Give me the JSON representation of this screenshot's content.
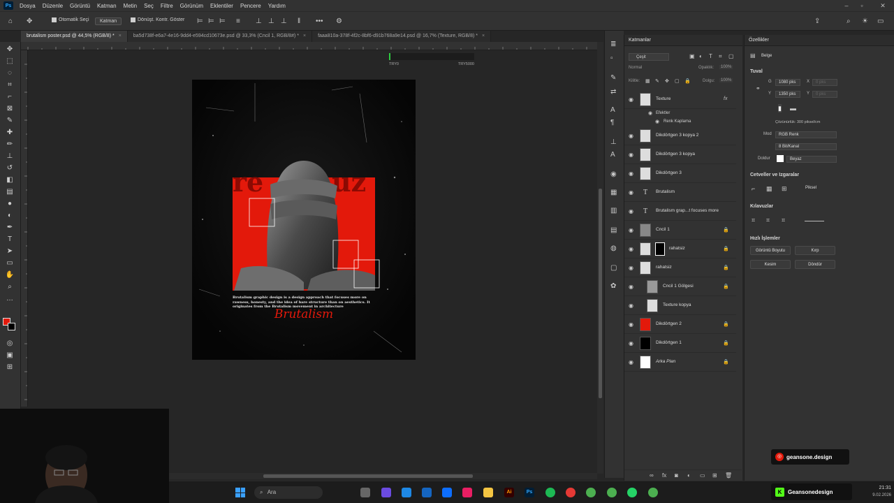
{
  "app": {
    "logo": "Ps",
    "menu": [
      "Dosya",
      "Düzenle",
      "Görüntü",
      "Katman",
      "Metin",
      "Seç",
      "Filtre",
      "Görünüm",
      "Eklentiler",
      "Pencere",
      "Yardım"
    ]
  },
  "options_bar": {
    "auto_select_label": "Otomatik Seçi",
    "auto_select_target": "Katman",
    "transform_controls_label": "Dönüşt. Kontr. Göster"
  },
  "tabs": [
    {
      "label": "brutalism poster.psd @ 44,5% (RGB/8) *",
      "active": true
    },
    {
      "label": "ba5d738f-e6a7-4e16-9dd4-e594cd10673e.psd @ 33,3% (Cncil 1, RGB/8#) *",
      "active": false
    },
    {
      "label": "faaa810a-378f-4f2c-8bf6-d91b768a9e14.psd @ 16,7% (Texture, RGB/8) *",
      "active": false
    }
  ],
  "progress": {
    "left_label": "TRY0",
    "right_label": "TRY5000",
    "value_pct": 2
  },
  "poster": {
    "title": "Brutalism",
    "body": "Brutalism graphic design is a design approach that focuses more on rawness, honesty, and the idea of bare structure than on aesthetics. It originates from the Brutalism movement in architecture"
  },
  "layers_panel": {
    "title": "Katmanlar",
    "filter_label": "Çeşit",
    "blend_mode": "Normal",
    "opacity_label": "Opaklık:",
    "opacity_value": "100%",
    "lock_label": "Kilitle:",
    "fill_label": "Dolgu:",
    "fill_value": "100%",
    "effects_label": "Efektler",
    "color_overlay_label": "Renk Kaplama",
    "layers": [
      {
        "name": "Texture",
        "kind": "pixel",
        "fx": true
      },
      {
        "name": "Dikdörtgen 3 kopya 2",
        "kind": "pixel"
      },
      {
        "name": "Dikdörtgen 3 kopya",
        "kind": "pixel"
      },
      {
        "name": "Dikdörtgen 3",
        "kind": "pixel"
      },
      {
        "name": "Brutalism",
        "kind": "text"
      },
      {
        "name": "Brutalism grap...t focuses more",
        "kind": "text"
      },
      {
        "name": "Cncil 1",
        "kind": "pixel",
        "locked": true
      },
      {
        "name": "rahatsiz",
        "kind": "pixel",
        "locked": true
      },
      {
        "name": "rahatsiz",
        "kind": "pixel",
        "locked": true
      },
      {
        "name": "Cncil 1 Gölgesi",
        "kind": "pixel",
        "locked": true
      },
      {
        "name": "Texture kopya",
        "kind": "pixel"
      },
      {
        "name": "Dikdörtgen 2",
        "kind": "pixel",
        "locked": true
      },
      {
        "name": "Dikdörtgen 1",
        "kind": "pixel",
        "locked": true
      },
      {
        "name": "Arka Plan",
        "kind": "bg",
        "locked": true
      }
    ]
  },
  "properties_panel": {
    "title": "Özellikler",
    "doc_label": "Belge",
    "canvas_section": "Tuval",
    "width_label": "G",
    "width_value": "1080 pks",
    "height_label": "Y",
    "height_value": "1350 pks",
    "x_label": "X",
    "x_value": "0 pks",
    "y_label": "Y",
    "y_value": "0 pks",
    "resolution": "Çözünürlük: 300 piksel/cm",
    "mode_label": "Mod",
    "mode_value": "RGB Renk",
    "bitdepth_value": "8 Bit/Kanal",
    "fill_label": "Doldur",
    "fill_value": "Beyaz",
    "rulers_section": "Cetveller ve Izgaralar",
    "rulers_unit": "Piksel",
    "guides_section": "Kılavuzlar",
    "quick_section": "Hızlı İşlemler",
    "quick_buttons": [
      "Görüntü Boyutu",
      "Kırp",
      "Kesim",
      "Döndür"
    ]
  },
  "taskbar": {
    "search_label": "Ara",
    "time": "21:31",
    "date": "9.02.2026",
    "badge1": "geansone.design",
    "badge2": "Geansonedesign"
  },
  "colors": {
    "accent_red": "#e3190b",
    "panel_bg": "#323232",
    "canvas_bg": "#262626"
  }
}
